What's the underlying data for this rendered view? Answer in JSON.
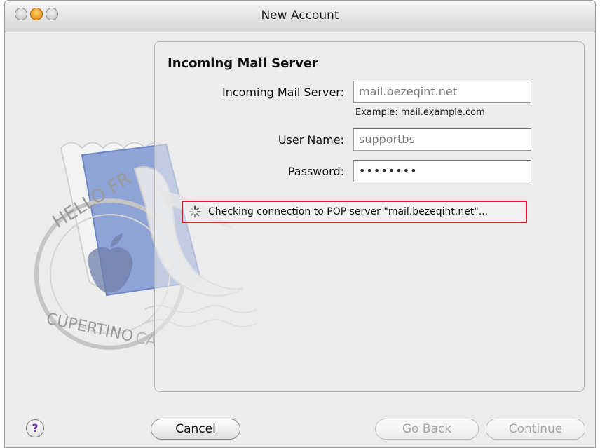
{
  "window": {
    "title": "New Account"
  },
  "panel": {
    "title": "Incoming Mail Server",
    "fields": {
      "server_label": "Incoming Mail Server:",
      "server_value": "mail.bezeqint.net",
      "server_example": "Example: mail.example.com",
      "username_label": "User Name:",
      "username_value": "supportbs",
      "password_label": "Password:",
      "password_value": "••••••••"
    },
    "status": "Checking connection to POP server \"mail.bezeqint.net\"...",
    "stamp": {
      "top_text": "HELLO FR",
      "bottom_text": "CUPERTINO",
      "suffix": "CA"
    }
  },
  "buttons": {
    "help": "?",
    "cancel": "Cancel",
    "go_back": "Go Back",
    "continue": "Continue"
  },
  "colors": {
    "highlight_border": "#d0202a",
    "help_glyph": "#6a2fb8"
  }
}
